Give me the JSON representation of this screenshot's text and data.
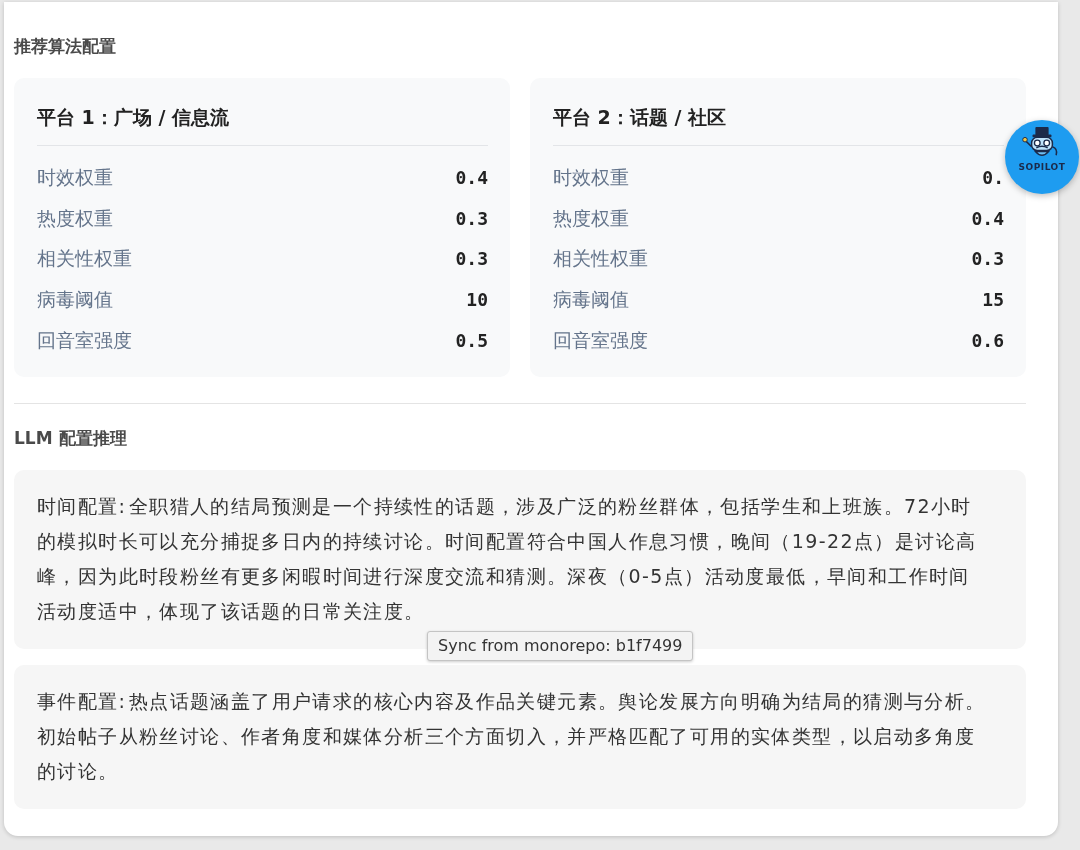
{
  "recommendation_config": {
    "title": "推荐算法配置",
    "platforms": [
      {
        "title": "平台 1：广场 / 信息流",
        "params": [
          {
            "label": "时效权重",
            "value": "0.4"
          },
          {
            "label": "热度权重",
            "value": "0.3"
          },
          {
            "label": "相关性权重",
            "value": "0.3"
          },
          {
            "label": "病毒阈值",
            "value": "10"
          },
          {
            "label": "回音室强度",
            "value": "0.5"
          }
        ]
      },
      {
        "title": "平台 2：话题 / 社区",
        "params": [
          {
            "label": "时效权重",
            "value": "0."
          },
          {
            "label": "热度权重",
            "value": "0.4"
          },
          {
            "label": "相关性权重",
            "value": "0.3"
          },
          {
            "label": "病毒阈值",
            "value": "15"
          },
          {
            "label": "回音室强度",
            "value": "0.6"
          }
        ]
      }
    ]
  },
  "llm_reasoning": {
    "title": "LLM 配置推理",
    "paragraphs": [
      {
        "text": "时间配置: 全职猎人的结局预测是一个持续性的话题，涉及广泛的粉丝群体，包括学生和上班族。72小时的模拟时长可以充分捕捉多日内的持续讨论。时间配置符合中国人作息习惯，晚间（19-22点）是讨论高峰，因为此时段粉丝有更多闲暇时间进行深度交流和猜测。深夜（0-5点）活动度最低，早间和工作时间活动度适中，体现了该话题的日常关注度。",
        "tooltip": "Sync from monorepo: b1f7499"
      },
      {
        "text": "事件配置: 热点话题涵盖了用户请求的核心内容及作品关键元素。舆论发展方向明确为结局的猜测与分析。初始帖子从粉丝讨论、作者角度和媒体分析三个方面切入，并严格匹配了可用的实体类型，以启动多角度的讨论。"
      }
    ]
  },
  "floating_button": {
    "label": "SOPILOT"
  }
}
